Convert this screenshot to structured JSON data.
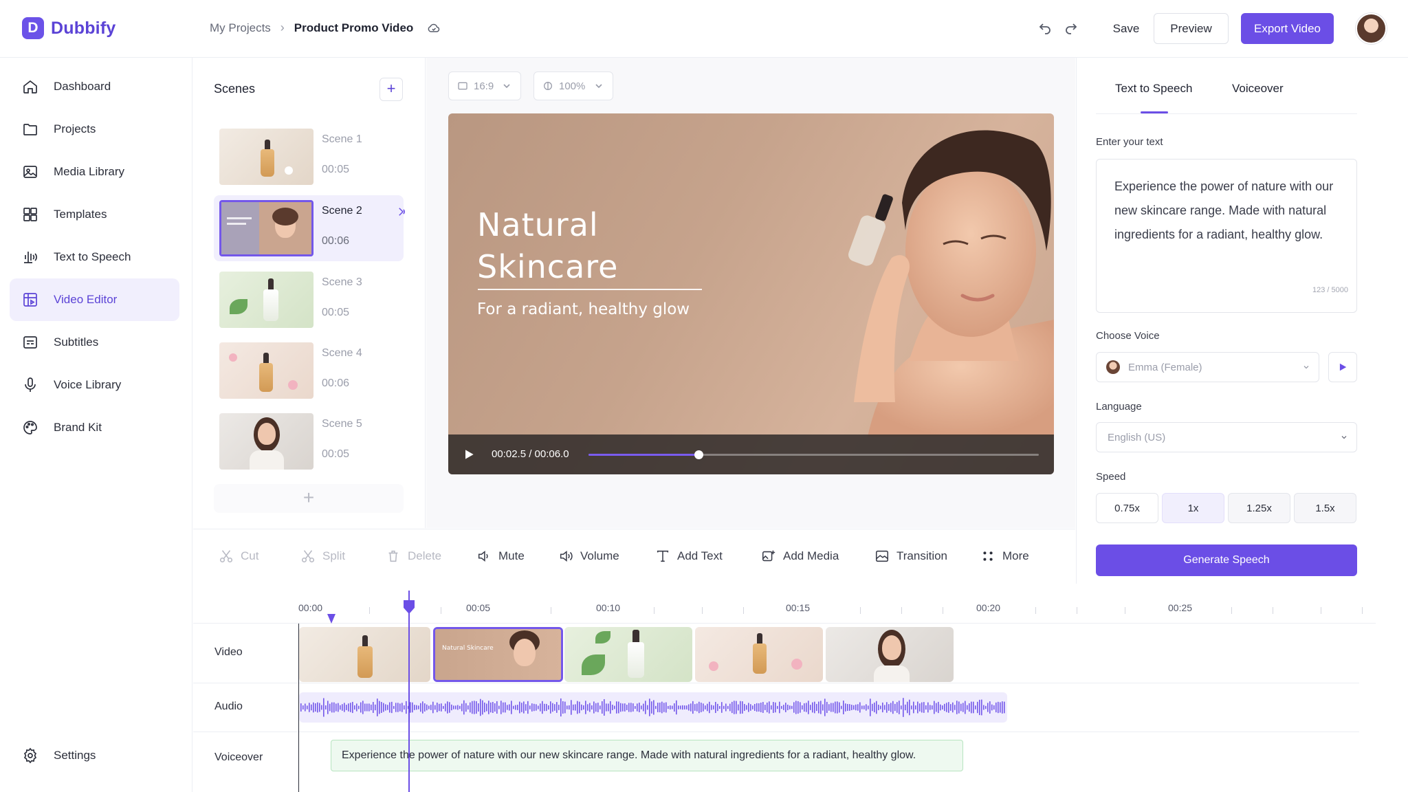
{
  "app": {
    "name": "Dubbify",
    "logo_letter": "D",
    "accent": "#6b4ee6"
  },
  "header": {
    "breadcrumb_root": "My Projects",
    "breadcrumb_current": "Product Promo Video",
    "save_label": "Save",
    "preview_label": "Preview",
    "export_label": "Export Video"
  },
  "sidebar": {
    "items": [
      {
        "label": "Dashboard",
        "icon": "home-icon"
      },
      {
        "label": "Projects",
        "icon": "folder-icon"
      },
      {
        "label": "Media Library",
        "icon": "image-icon"
      },
      {
        "label": "Templates",
        "icon": "grid-icon"
      },
      {
        "label": "Text to Speech",
        "icon": "speech-icon"
      },
      {
        "label": "Video Editor",
        "icon": "video-editor-icon",
        "active": true
      },
      {
        "label": "Subtitles",
        "icon": "subtitles-icon"
      },
      {
        "label": "Voice Library",
        "icon": "voice-icon"
      },
      {
        "label": "Brand Kit",
        "icon": "palette-icon"
      }
    ],
    "settings_label": "Settings"
  },
  "scenes": {
    "title": "Scenes",
    "items": [
      {
        "name": "Scene 1",
        "duration": "00:05"
      },
      {
        "name": "Scene 2",
        "duration": "00:06",
        "active": true
      },
      {
        "name": "Scene 3",
        "duration": "00:05"
      },
      {
        "name": "Scene 4",
        "duration": "00:06"
      },
      {
        "name": "Scene 5",
        "duration": "00:05"
      }
    ]
  },
  "preview": {
    "aspect": "16:9",
    "zoom": "100%",
    "title": "Natural Skincare",
    "subtitle": "For a radiant, healthy glow",
    "time": "00:02.5 / 00:06.0",
    "progress": 0.245
  },
  "right_panel": {
    "tab_tts": "Text to Speech",
    "tab_voiceover": "Voiceover",
    "text_label": "Enter your text",
    "text_value": "Experience the power of nature with our new skincare range. Made with natural ingredients for a radiant, healthy glow.",
    "char_count": "123 / 5000",
    "voice_label": "Choose Voice",
    "voice_value": "Emma (Female)",
    "language_label": "Language",
    "language_value": "English (US)",
    "speed_label": "Speed",
    "speeds": [
      "0.75x",
      "1x",
      "1.25x",
      "1.5x"
    ],
    "selected_speed": "1x",
    "generate_label": "Generate Speech"
  },
  "toolbar": {
    "cut": "Cut",
    "split": "Split",
    "delete": "Delete",
    "mute": "Mute",
    "volume": "Volume",
    "add_text": "Add Text",
    "add_media": "Add Media",
    "transition": "Transition",
    "more": "More"
  },
  "timeline": {
    "ticks": [
      "00:00",
      "00:05",
      "00:10",
      "00:15",
      "00:20",
      "00:25"
    ],
    "tracks": {
      "video": "Video",
      "audio": "Audio",
      "voiceover": "Voiceover"
    },
    "voiceover_text": "Experience the power of nature with our new skincare range. Made with natural ingredients for a radiant, healthy glow.",
    "clip_caption": "Natural Skincare"
  }
}
